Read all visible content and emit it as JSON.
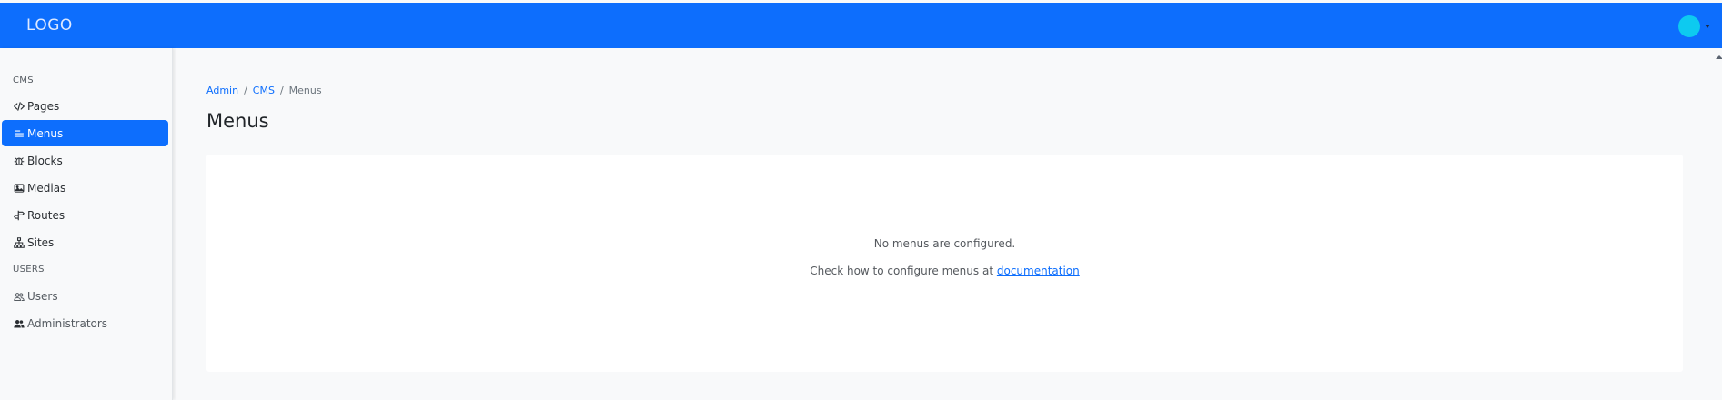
{
  "header": {
    "logo": "LOGO",
    "colors": {
      "primary": "#0d6efd",
      "avatar": "#0dcaf0"
    }
  },
  "sidebar": {
    "sections": [
      {
        "label": "CMS",
        "items": [
          {
            "label": "Pages",
            "icon": "code-icon",
            "active": false
          },
          {
            "label": "Menus",
            "icon": "menu-lines-icon",
            "active": true
          },
          {
            "label": "Blocks",
            "icon": "bug-icon",
            "active": false
          },
          {
            "label": "Medias",
            "icon": "image-icon",
            "active": false
          },
          {
            "label": "Routes",
            "icon": "signpost-icon",
            "active": false
          },
          {
            "label": "Sites",
            "icon": "sitemap-icon",
            "active": false
          }
        ]
      },
      {
        "label": "USERS",
        "items": [
          {
            "label": "Users",
            "icon": "people-outline-icon",
            "active": false
          },
          {
            "label": "Administrators",
            "icon": "people-fill-icon",
            "active": false
          }
        ]
      }
    ]
  },
  "breadcrumb": {
    "items": [
      "Admin",
      "CMS"
    ],
    "current": "Menus",
    "separator": "/"
  },
  "main": {
    "title": "Menus",
    "empty_message": "No menus are configured.",
    "help_prefix": "Check how to configure menus at",
    "help_link": "documentation"
  }
}
